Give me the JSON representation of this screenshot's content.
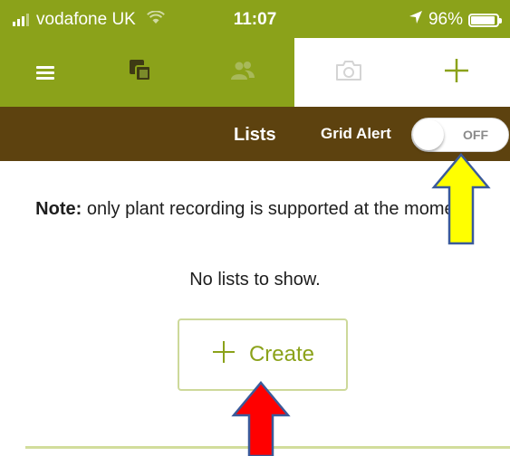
{
  "status_bar": {
    "carrier": "vodafone UK",
    "time": "11:07",
    "battery": "96%",
    "battery_level": 0.96
  },
  "tabs": [
    {
      "name": "menu",
      "icon": "hamburger-menu-icon"
    },
    {
      "name": "gallery",
      "icon": "gallery-icon"
    },
    {
      "name": "people",
      "icon": "people-icon"
    },
    {
      "name": "camera",
      "icon": "camera-icon"
    },
    {
      "name": "add",
      "icon": "plus-icon"
    }
  ],
  "header": {
    "title": "Lists",
    "grid_alert_label": "Grid Alert",
    "toggle_state": "OFF"
  },
  "content": {
    "note_bold": "Note:",
    "note_text": " only plant recording is supported at the moment.",
    "empty_text": "No lists to show.",
    "create_label": "Create"
  },
  "colors": {
    "brand_green": "#8ba21a",
    "header_brown": "#5d420f",
    "button_border": "#cdd99a",
    "arrow_yellow": "#ffff00",
    "arrow_red": "#ff0000",
    "arrow_outline": "#3a5a9a"
  }
}
